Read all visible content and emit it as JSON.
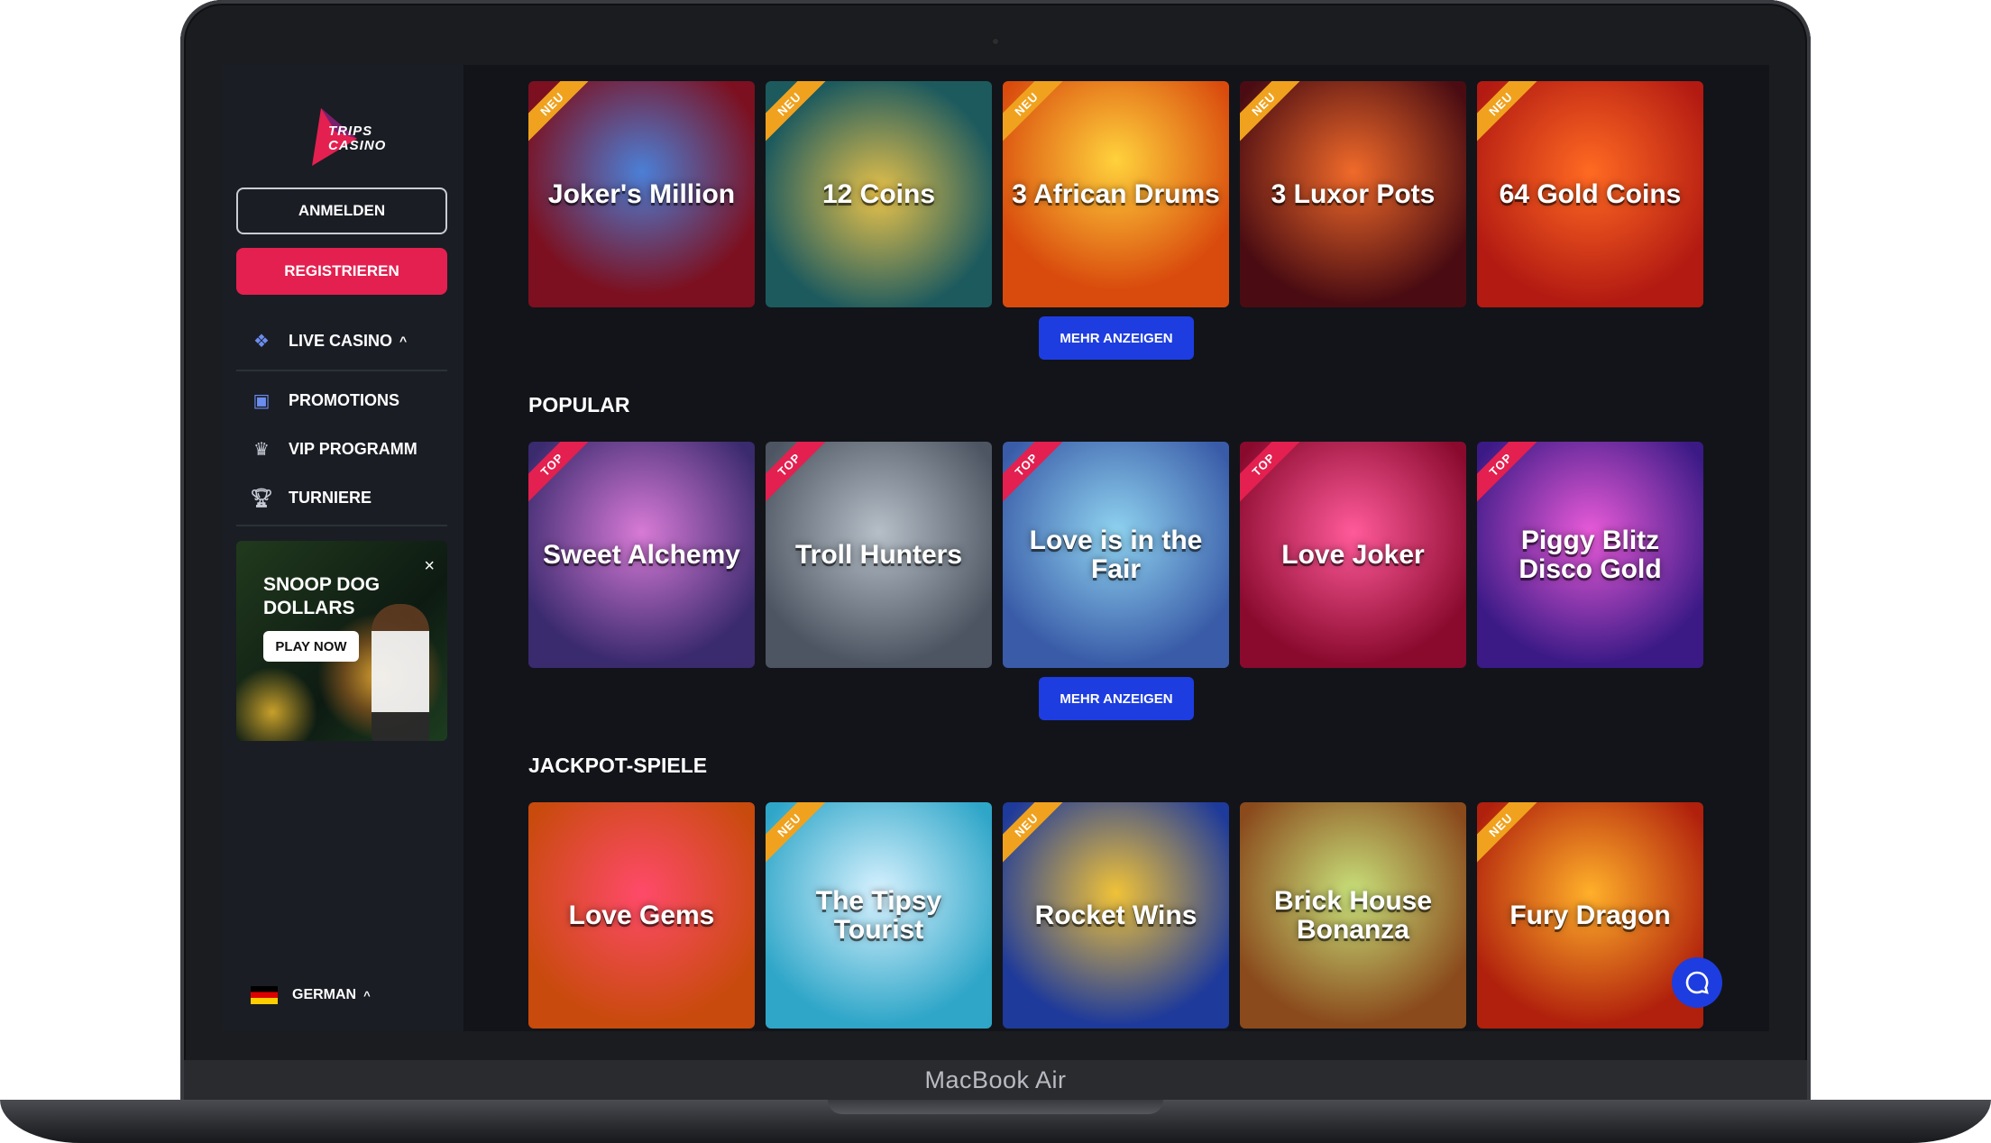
{
  "device": {
    "label": "MacBook Air"
  },
  "brand": {
    "logo_line1": "TRIPS",
    "logo_line2": "CASINO",
    "accent": "#e3204f",
    "primary": "#1d3de0"
  },
  "sidebar": {
    "login_label": "ANMELDEN",
    "register_label": "REGISTRIEREN",
    "items": [
      {
        "label": "LIVE CASINO",
        "icon": "live-casino-icon",
        "expand": "^"
      },
      {
        "label": "PROMOTIONS",
        "icon": "gift-icon"
      },
      {
        "label": "VIP PROGRAMM",
        "icon": "crown-icon"
      },
      {
        "label": "TURNIERE",
        "icon": "trophy-icon"
      }
    ],
    "promo": {
      "title_line1": "SNOOP DOG",
      "title_line2": "DOLLARS",
      "button": "PLAY NOW",
      "close": "×"
    },
    "language": {
      "label": "GERMAN",
      "expand": "^"
    }
  },
  "main": {
    "more_label": "MEHR ANZEIGEN",
    "sections": [
      {
        "title": "",
        "games": [
          {
            "name": "Joker's Million",
            "badge": "NEU"
          },
          {
            "name": "12 Coins",
            "badge": "NEU"
          },
          {
            "name": "3 African Drums",
            "badge": "NEU"
          },
          {
            "name": "3 Luxor Pots",
            "badge": "NEU"
          },
          {
            "name": "64 Gold Coins",
            "badge": "NEU"
          }
        ]
      },
      {
        "title": "POPULAR",
        "games": [
          {
            "name": "Sweet Alchemy",
            "badge": "TOP"
          },
          {
            "name": "Troll Hunters",
            "badge": "TOP"
          },
          {
            "name": "Love is in the Fair",
            "badge": "TOP"
          },
          {
            "name": "Love Joker",
            "badge": "TOP"
          },
          {
            "name": "Piggy Blitz Disco Gold",
            "badge": "TOP"
          }
        ]
      },
      {
        "title": "JACKPOT-SPIELE",
        "games": [
          {
            "name": "Love Gems",
            "badge": ""
          },
          {
            "name": "The Tipsy Tourist",
            "badge": "NEU"
          },
          {
            "name": "Rocket Wins",
            "badge": "NEU"
          },
          {
            "name": "Brick House Bonanza",
            "badge": ""
          },
          {
            "name": "Fury Dragon",
            "badge": "NEU"
          }
        ]
      }
    ]
  },
  "chat": {
    "icon": "chat-icon"
  }
}
